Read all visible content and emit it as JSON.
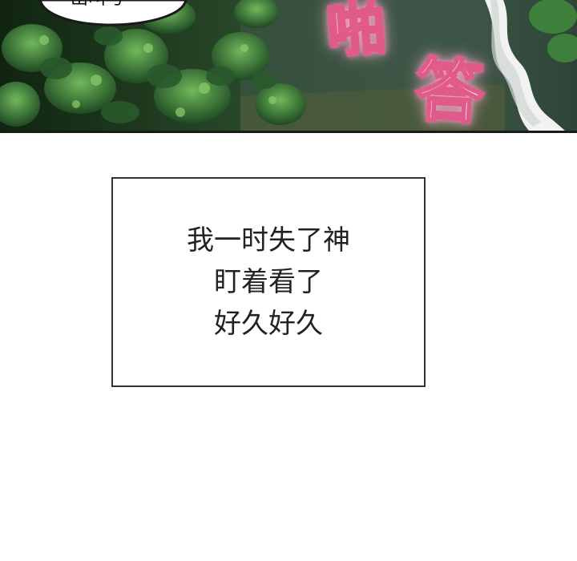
{
  "panel_top": {
    "speech_bubble_fragment": "出叫与·",
    "sound_effects": [
      "啪",
      "答"
    ]
  },
  "caption": {
    "lines": [
      "我一时失了神",
      "盯着看了",
      "好久好久"
    ]
  },
  "colors": {
    "foliage_dark": "#16301a",
    "foliage_mid": "#2f6a33",
    "foliage_light": "#5aa24a",
    "sfx_outline": "#e05a8a",
    "sfx_glow": "#ff9dc2",
    "caption_border": "#333333",
    "caption_text": "#222222"
  }
}
